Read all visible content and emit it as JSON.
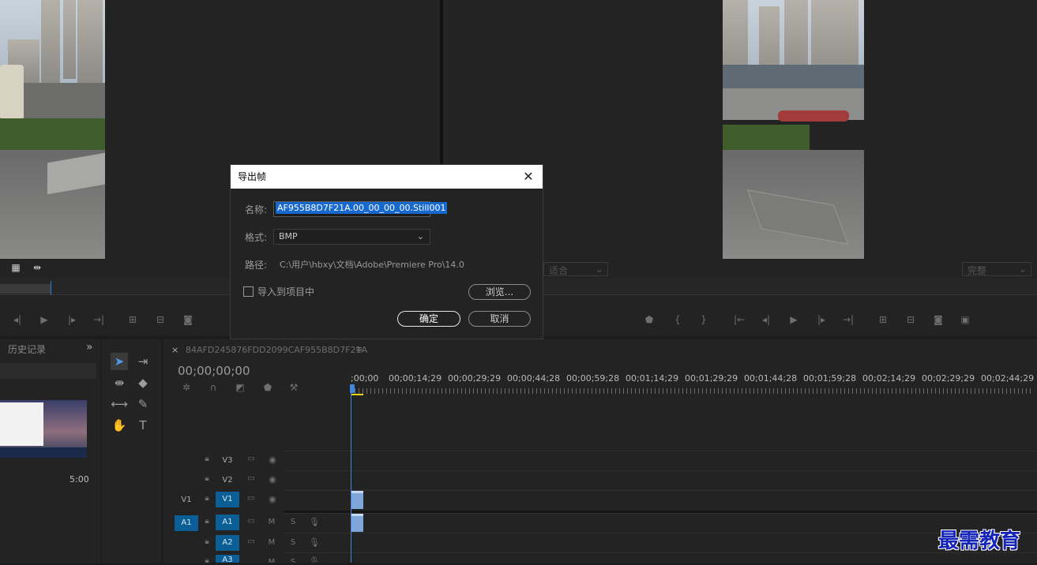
{
  "dialog": {
    "title": "导出帧",
    "close": "✕",
    "name_label": "名称:",
    "name_value": "AF955B8D7F21A.00_00_00_00.Still001",
    "format_label": "格式:",
    "format_value": "BMP",
    "path_label": "路径:",
    "path_value": "C:\\用户\\hbxy\\文档\\Adobe\\Premiere Pro\\14.0",
    "import_label": "导入到项目中",
    "browse_label": "浏览...",
    "ok_label": "确定",
    "cancel_label": "取消"
  },
  "program_monitor": {
    "fit_value": "适合",
    "quality_value": "完整"
  },
  "history_panel": {
    "title": "历史记录",
    "more": "»",
    "thumb_time": "5:00"
  },
  "timeline": {
    "close": "×",
    "sequence_name": "84AFD245876FDD2099CAF955B8D7F21A",
    "menu": "≡",
    "timecode": "00;00;00;00",
    "ruler": [
      ";00;00",
      "00;00;14;29",
      "00;00;29;29",
      "00;00;44;28",
      "00;00;59;28",
      "00;01;14;29",
      "00;01;29;29",
      "00;01;44;28",
      "00;01;59;28",
      "00;02;14;29",
      "00;02;29;29",
      "00;02;44;29"
    ],
    "tracks": {
      "v3": "V3",
      "v2": "V2",
      "v1_src": "V1",
      "v1": "V1",
      "a1_src": "A1",
      "a1": "A1",
      "a2": "A2",
      "a3": "A3",
      "m": "M",
      "s": "S"
    }
  },
  "watermark": "最需教育"
}
